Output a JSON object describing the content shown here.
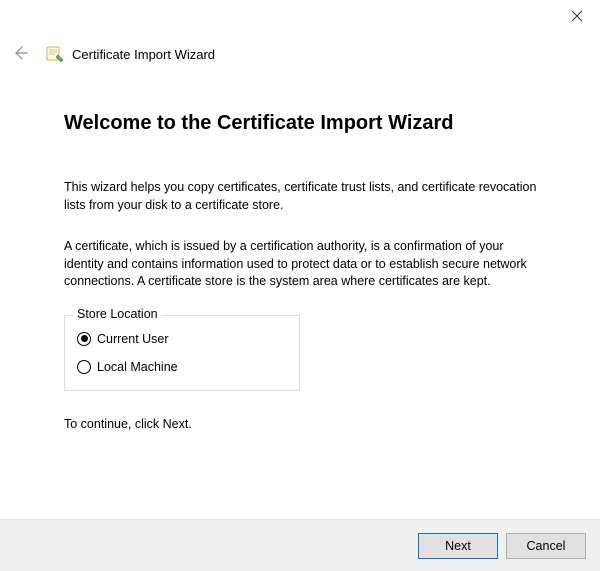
{
  "header": {
    "title": "Certificate Import Wizard"
  },
  "main": {
    "title": "Welcome to the Certificate Import Wizard",
    "paragraph1": "This wizard helps you copy certificates, certificate trust lists, and certificate revocation lists from your disk to a certificate store.",
    "paragraph2": "A certificate, which is issued by a certification authority, is a confirmation of your identity and contains information used to protect data or to establish secure network connections. A certificate store is the system area where certificates are kept.",
    "store_location": {
      "legend": "Store Location",
      "option_current_user": "Current User",
      "option_local_machine": "Local Machine",
      "selected": "Current User"
    },
    "continue_text": "To continue, click Next."
  },
  "footer": {
    "next_label": "Next",
    "cancel_label": "Cancel"
  }
}
